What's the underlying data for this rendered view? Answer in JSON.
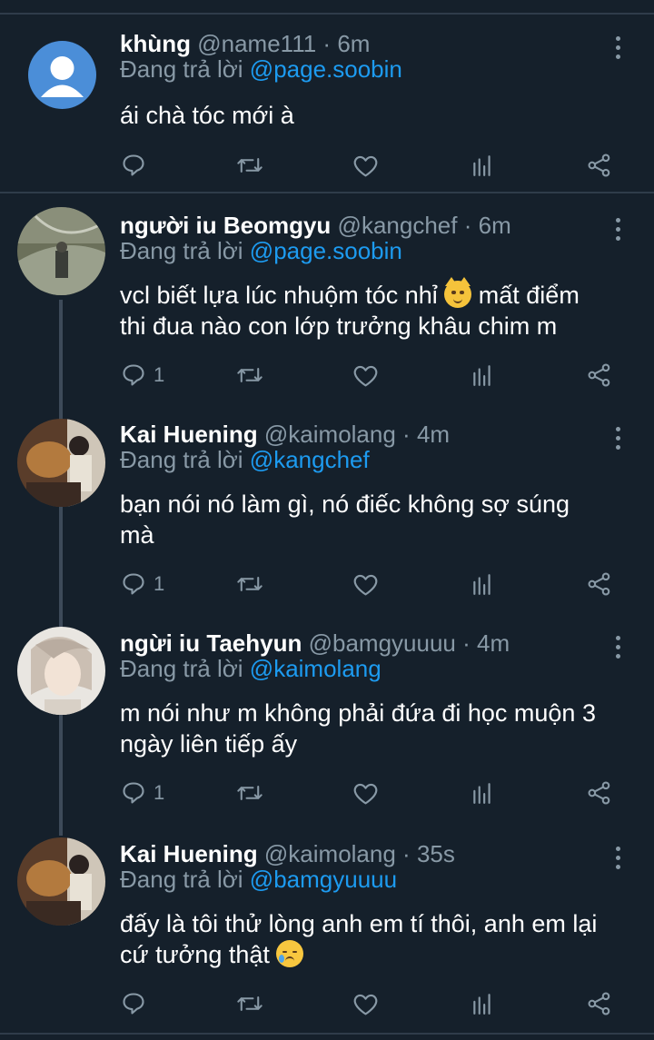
{
  "colors": {
    "background": "#15202b",
    "accent": "#1d9bf0",
    "muted": "#8899a6",
    "divider": "#2f3c4a"
  },
  "reply_prefix": "Đang trả lời",
  "tweets": [
    {
      "name": "khùng",
      "handle": "@name111",
      "time": "6m",
      "reply_to": "@page.soobin",
      "text": "ái chà tóc mới à",
      "reply_count": "",
      "avatar": "default-avatar"
    },
    {
      "name": "người iu Beomgyu",
      "handle": "@kangchef",
      "time": "6m",
      "reply_to": "@page.soobin",
      "text_line1a": "vcl biết lựa lúc nhuộm tóc nhỉ",
      "text_line1b": "mất điểm",
      "text_line2": "thi đua nào con lớp trưởng khâu chim m",
      "reply_count": "1",
      "avatar": "photo-avatar"
    },
    {
      "name": "Kai Huening",
      "handle": "@kaimolang",
      "time": "4m",
      "reply_to": "@kangchef",
      "text": "bạn nói nó làm gì, nó điếc không sợ súng mà",
      "reply_count": "1",
      "avatar": "photo-avatar"
    },
    {
      "name": "ngừi iu Taehyun",
      "handle": "@bamgyuuuu",
      "time": "4m",
      "reply_to": "@kaimolang",
      "text": "m nói như m không phải đứa đi học muộn 3 ngày liên tiếp ấy",
      "reply_count": "1",
      "avatar": "photo-avatar"
    },
    {
      "name": "Kai Huening",
      "handle": "@kaimolang",
      "time": "35s",
      "reply_to": "@bamgyuuuu",
      "text_line1": "đấy là tôi thử lòng anh em tí thôi, anh em lại",
      "text_line2": "cứ tưởng thật",
      "reply_count": "",
      "avatar": "photo-avatar"
    }
  ]
}
